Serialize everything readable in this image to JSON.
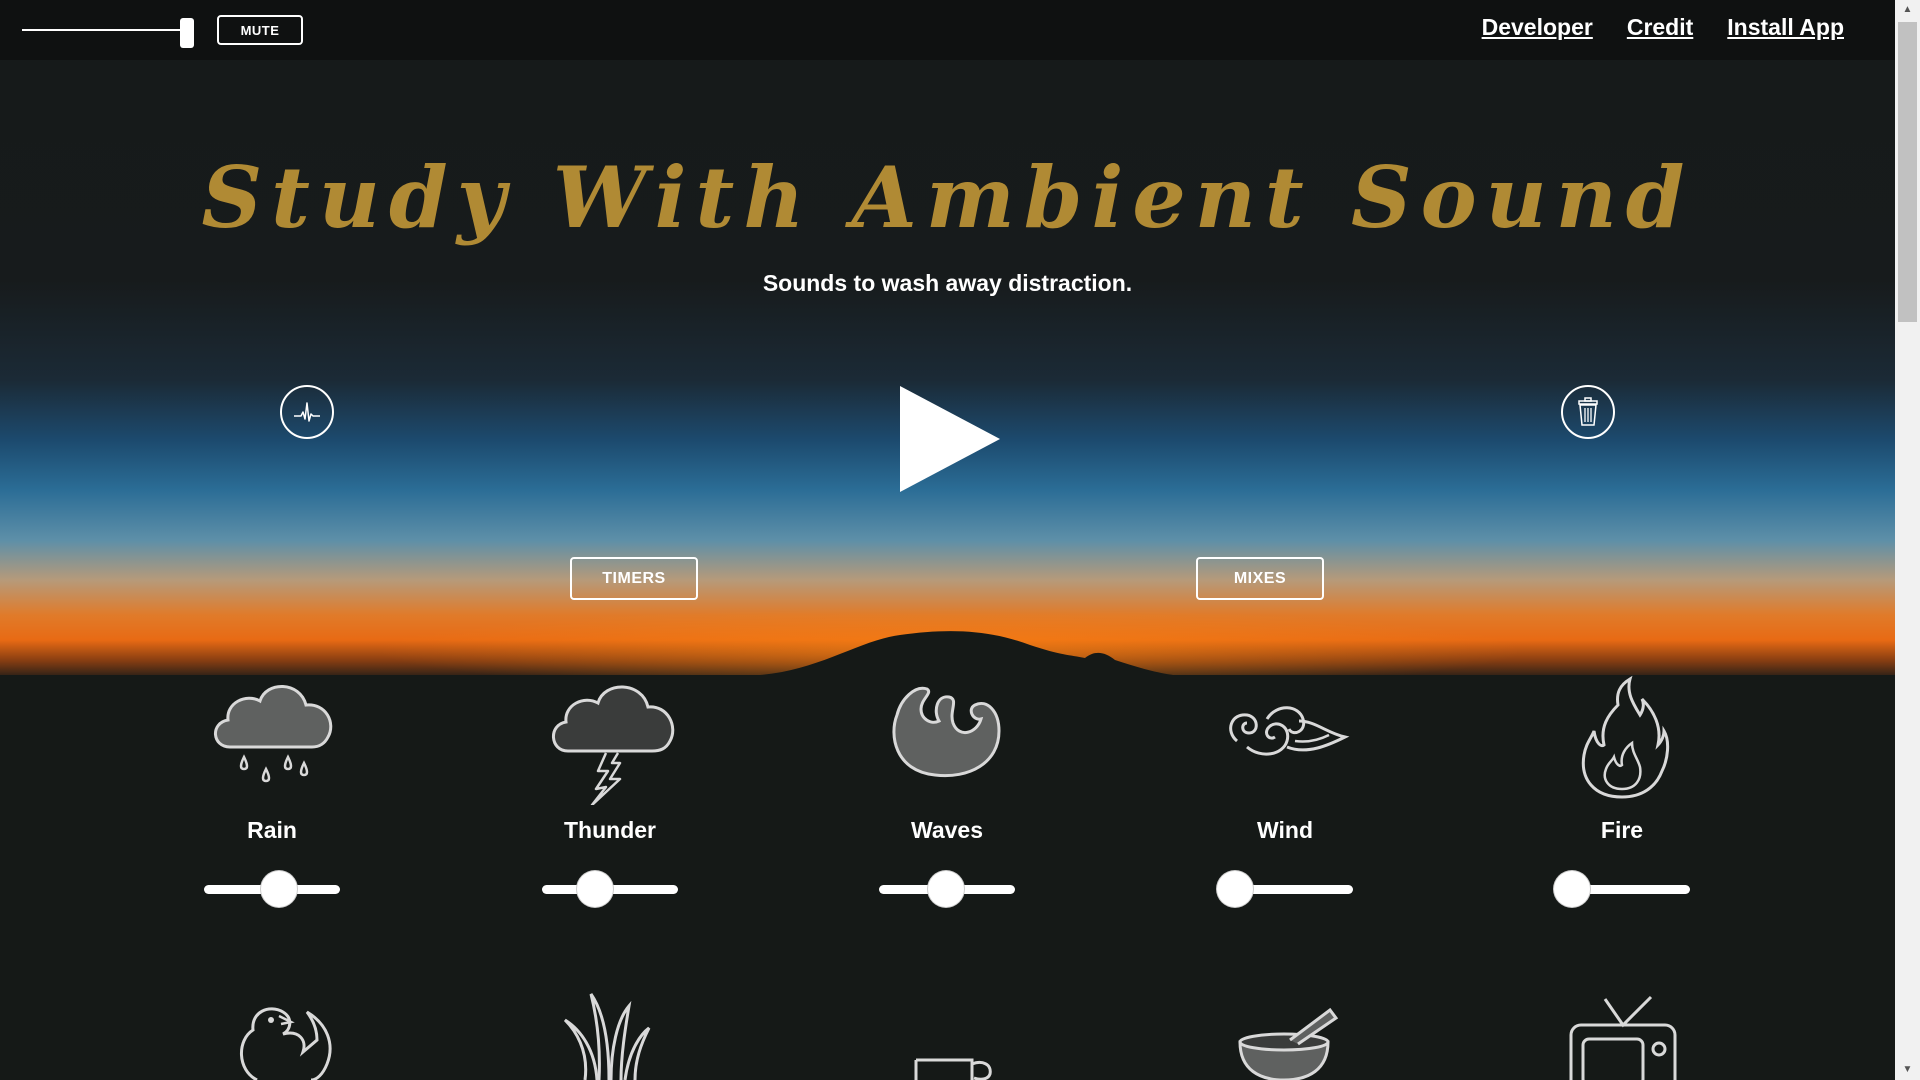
{
  "topbar": {
    "master_volume": 0.95,
    "mute_label": "MUTE",
    "links": [
      "Developer",
      "Credit",
      "Install App"
    ]
  },
  "hero": {
    "title": "Study With Ambient Sound",
    "subtitle": "Sounds to wash away distraction.",
    "left_icon": "waveform-icon",
    "right_icon": "trash-icon",
    "play_icon": "play-icon",
    "timers_label": "TIMERS",
    "mixes_label": "MIXES"
  },
  "colors": {
    "title": "#b08a34",
    "background": "#151917",
    "icon_fill": "#5f6160"
  },
  "sounds": [
    {
      "name": "Rain",
      "icon": "rain-cloud-icon",
      "volume": 0.57
    },
    {
      "name": "Thunder",
      "icon": "thunder-cloud-icon",
      "volume": 0.35
    },
    {
      "name": "Waves",
      "icon": "waves-icon",
      "volume": 0.49
    },
    {
      "name": "Wind",
      "icon": "wind-icon",
      "volume": 0.0
    },
    {
      "name": "Fire",
      "icon": "fire-icon",
      "volume": 0.0
    }
  ],
  "sounds_row2_icons": [
    "bird-icon",
    "grass-icon",
    "coffee-cup-icon",
    "singing-bowl-icon",
    "television-icon"
  ]
}
